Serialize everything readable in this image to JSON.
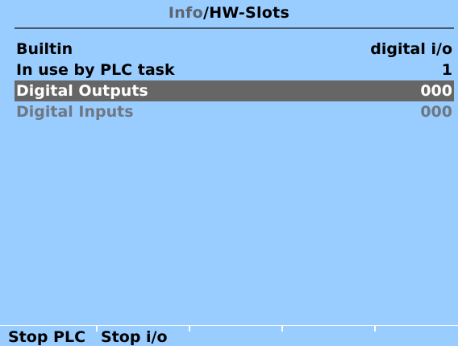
{
  "title": {
    "parent": "Info",
    "separator": "/",
    "current": "HW-Slots"
  },
  "rows": [
    {
      "label": "Builtin",
      "value": "digital i/o",
      "state": "normal"
    },
    {
      "label": "In use by PLC task",
      "value": "1",
      "state": "normal"
    },
    {
      "label": "Digital Outputs",
      "value": "000",
      "state": "selected"
    },
    {
      "label": "Digital Inputs",
      "value": "000",
      "state": "disabled"
    }
  ],
  "softkeys": [
    {
      "label": "Stop PLC"
    },
    {
      "label": "Stop i/o"
    },
    {
      "label": ""
    },
    {
      "label": ""
    },
    {
      "label": ""
    }
  ],
  "colors": {
    "background": "#99ccff",
    "selected_row": "#666666",
    "disabled_text": "#6e7782"
  }
}
